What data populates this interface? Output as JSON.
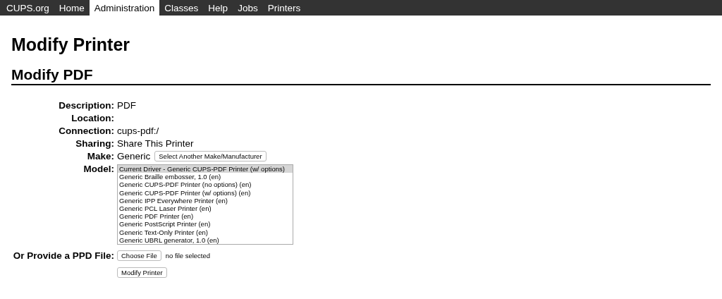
{
  "nav": [
    {
      "label": "CUPS.org",
      "selected": false
    },
    {
      "label": "Home",
      "selected": false
    },
    {
      "label": "Administration",
      "selected": true
    },
    {
      "label": "Classes",
      "selected": false
    },
    {
      "label": "Help",
      "selected": false
    },
    {
      "label": "Jobs",
      "selected": false
    },
    {
      "label": "Printers",
      "selected": false
    }
  ],
  "title": "Modify Printer",
  "subtitle": "Modify PDF",
  "fields": [
    {
      "kind": "text",
      "label": "Description:",
      "value": "PDF"
    },
    {
      "kind": "text",
      "label": "Location:"
    },
    {
      "kind": "text",
      "label": "Connection:",
      "value": "cups-pdf:/"
    },
    {
      "kind": "text",
      "label": "Sharing:",
      "value": "Share This Printer"
    },
    {
      "kind": "button",
      "label": "Make:",
      "value": "Generic",
      "button": "Select Another Make/Manufacturer"
    },
    {
      "kind": "list",
      "label": "Model:",
      "options": [
        {
          "label": "Current Driver - Generic CUPS-PDF Printer (w/ options)",
          "selected": true
        },
        {
          "label": "Generic Braille embosser, 1.0 (en)",
          "selected": false
        },
        {
          "label": "Generic CUPS-PDF Printer (no options) (en)",
          "selected": false
        },
        {
          "label": "Generic CUPS-PDF Printer (w/ options) (en)",
          "selected": false
        },
        {
          "label": "Generic IPP Everywhere Printer (en)",
          "selected": false
        },
        {
          "label": "Generic PCL Laser Printer (en)",
          "selected": false
        },
        {
          "label": "Generic PDF Printer (en)",
          "selected": false
        },
        {
          "label": "Generic PostScript Printer (en)",
          "selected": false
        },
        {
          "label": "Generic Text-Only Printer (en)",
          "selected": false
        },
        {
          "label": "Generic UBRL generator, 1.0 (en)",
          "selected": false
        }
      ]
    },
    {
      "kind": "file",
      "label": "Or Provide a PPD File:",
      "button": "Choose File",
      "status": "no file selected"
    }
  ],
  "submit": "Modify Printer"
}
